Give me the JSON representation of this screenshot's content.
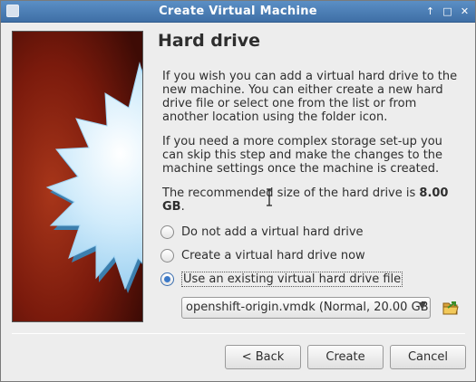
{
  "window": {
    "title": "Create Virtual Machine",
    "controls": [
      "↑",
      "□",
      "✕"
    ]
  },
  "page": {
    "heading": "Hard drive",
    "paragraph1": "If you wish you can add a virtual hard drive to the new machine. You can either create a new hard drive file or select one from the list or from another location using the folder icon.",
    "paragraph2": "If you need a more complex storage set-up you can skip this step and make the changes to the machine settings once the machine is created.",
    "recommend_prefix": "The recommended size of the hard drive is ",
    "recommend_value": "8.00 GB",
    "recommend_suffix": "."
  },
  "options": [
    {
      "label": "Do not add a virtual hard drive",
      "checked": false
    },
    {
      "label": "Create a virtual hard drive now",
      "checked": false
    },
    {
      "label": "Use an existing virtual hard drive file",
      "checked": true
    }
  ],
  "disk_select": {
    "value": "openshift-origin.vmdk (Normal, 20.00 GB)"
  },
  "buttons": {
    "back": "< Back",
    "create": "Create",
    "cancel": "Cancel"
  },
  "icons": {
    "folder": "folder-open-icon",
    "combo_arrow": "chevron-down-icon",
    "side_image": "starburst-wizard-image"
  }
}
